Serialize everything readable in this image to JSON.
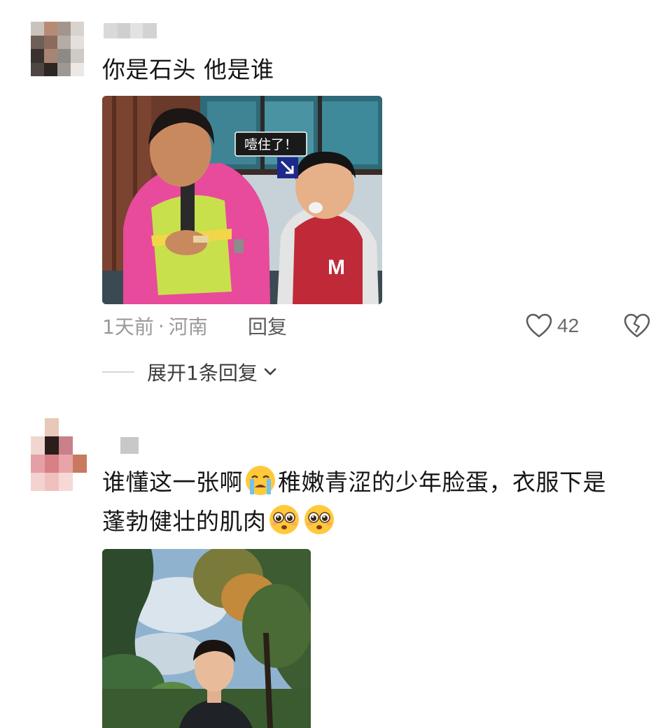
{
  "comments": [
    {
      "text": "你是石头 他是谁",
      "image": {
        "kind": "tv-show-screenshot",
        "caption": "噎住了！",
        "arrow_icon": "diagonal-arrow-down-right-icon"
      },
      "time": "1天前",
      "separator": "·",
      "location": "河南",
      "reply_label": "回复",
      "like_icon": "heart-outline-icon",
      "likes": "42",
      "dislike_icon": "broken-heart-icon",
      "expand_label": "展开1条回复",
      "expand_icon": "chevron-down-icon"
    },
    {
      "text_part1": "谁懂这一张啊",
      "emoji_1": "crying-face-emoji",
      "text_part2": "稚嫩青涩的少年脸蛋，衣服下是",
      "text_line2": "蓬勃健壮的肌肉",
      "emoji_2": "pleading-face-emoji",
      "emoji_3": "pleading-face-emoji",
      "image": {
        "kind": "outdoor-portrait-photo"
      }
    }
  ],
  "colors": {
    "text_primary": "#161616",
    "text_meta": "#9a9a9a",
    "divider": "#d6d6d6",
    "emoji_yellow": "#ffc93b"
  }
}
